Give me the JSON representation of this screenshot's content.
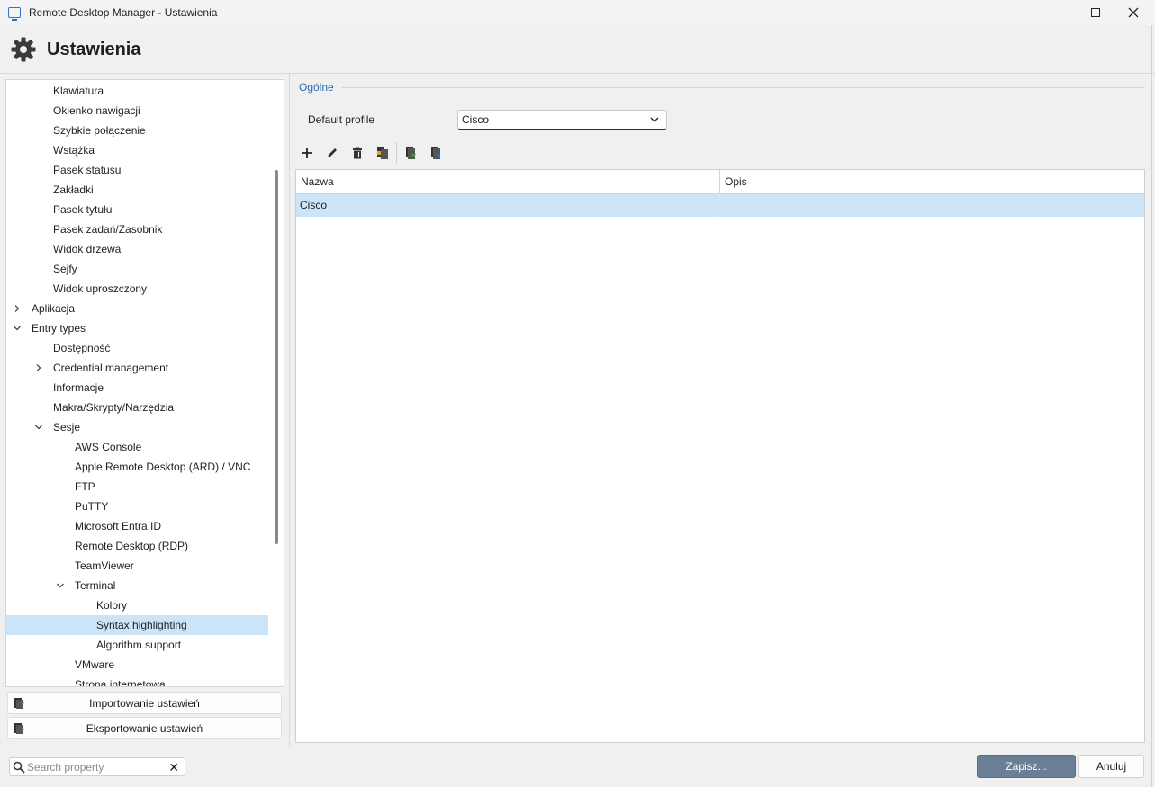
{
  "window": {
    "title": "Remote Desktop Manager - Ustawienia",
    "icons": [
      "app-monitor-icon",
      "minimize-icon",
      "maximize-icon",
      "close-icon"
    ]
  },
  "header": {
    "title": "Ustawienia",
    "icon": "gear-icon"
  },
  "tree": {
    "items": [
      {
        "label": "Klawiatura",
        "level": 2,
        "expander": "none"
      },
      {
        "label": "Okienko nawigacji",
        "level": 2,
        "expander": "none"
      },
      {
        "label": "Szybkie połączenie",
        "level": 2,
        "expander": "none"
      },
      {
        "label": "Wstążka",
        "level": 2,
        "expander": "none"
      },
      {
        "label": "Pasek statusu",
        "level": 2,
        "expander": "none"
      },
      {
        "label": "Zakładki",
        "level": 2,
        "expander": "none"
      },
      {
        "label": "Pasek tytułu",
        "level": 2,
        "expander": "none"
      },
      {
        "label": "Pasek zadań/Zasobnik",
        "level": 2,
        "expander": "none"
      },
      {
        "label": "Widok drzewa",
        "level": 2,
        "expander": "none"
      },
      {
        "label": "Sejfy",
        "level": 2,
        "expander": "none"
      },
      {
        "label": "Widok uproszczony",
        "level": 2,
        "expander": "none"
      },
      {
        "label": "Aplikacja",
        "level": 1,
        "expander": "collapsed"
      },
      {
        "label": "Entry types",
        "level": 1,
        "expander": "expanded"
      },
      {
        "label": "Dostępność",
        "level": 2,
        "expander": "none"
      },
      {
        "label": "Credential management",
        "level": 2,
        "expander": "collapsed"
      },
      {
        "label": "Informacje",
        "level": 2,
        "expander": "none"
      },
      {
        "label": "Makra/Skrypty/Narzędzia",
        "level": 2,
        "expander": "none"
      },
      {
        "label": "Sesje",
        "level": 2,
        "expander": "expanded"
      },
      {
        "label": "AWS Console",
        "level": 3,
        "expander": "none"
      },
      {
        "label": "Apple Remote Desktop (ARD) / VNC",
        "level": 3,
        "expander": "none"
      },
      {
        "label": "FTP",
        "level": 3,
        "expander": "none"
      },
      {
        "label": "PuTTY",
        "level": 3,
        "expander": "none"
      },
      {
        "label": "Microsoft Entra ID",
        "level": 3,
        "expander": "none"
      },
      {
        "label": "Remote Desktop (RDP)",
        "level": 3,
        "expander": "none"
      },
      {
        "label": "TeamViewer",
        "level": 3,
        "expander": "none"
      },
      {
        "label": "Terminal",
        "level": 3,
        "expander": "expanded"
      },
      {
        "label": "Kolory",
        "level": 4,
        "expander": "none"
      },
      {
        "label": "Syntax highlighting",
        "level": 4,
        "expander": "none",
        "selected": true
      },
      {
        "label": "Algorithm support",
        "level": 4,
        "expander": "none"
      },
      {
        "label": "VMware",
        "level": 3,
        "expander": "none"
      },
      {
        "label": "Strona internetowa",
        "level": 3,
        "expander": "none"
      }
    ]
  },
  "side_buttons": {
    "import_label": "Importowanie ustawień",
    "export_label": "Eksportowanie ustawień",
    "import_icon": "import-settings-icon",
    "export_icon": "export-settings-icon"
  },
  "main": {
    "group_title": "Ogólne",
    "default_profile_label": "Default profile",
    "default_profile_value": "Cisco",
    "toolbar_icons": [
      "add-icon",
      "edit-icon",
      "delete-icon",
      "copy-icon",
      "import-icon",
      "export-icon"
    ],
    "table": {
      "columns": [
        "Nazwa",
        "Opis"
      ],
      "rows": [
        {
          "name": "Cisco",
          "description": "",
          "selected": true
        }
      ]
    }
  },
  "footer": {
    "search_placeholder": "Search property",
    "save_label": "Zapisz...",
    "cancel_label": "Anuluj"
  },
  "colors": {
    "selection": "#cce4f7",
    "accent_text": "#2a6db0",
    "primary_button": "#6a7f95"
  }
}
